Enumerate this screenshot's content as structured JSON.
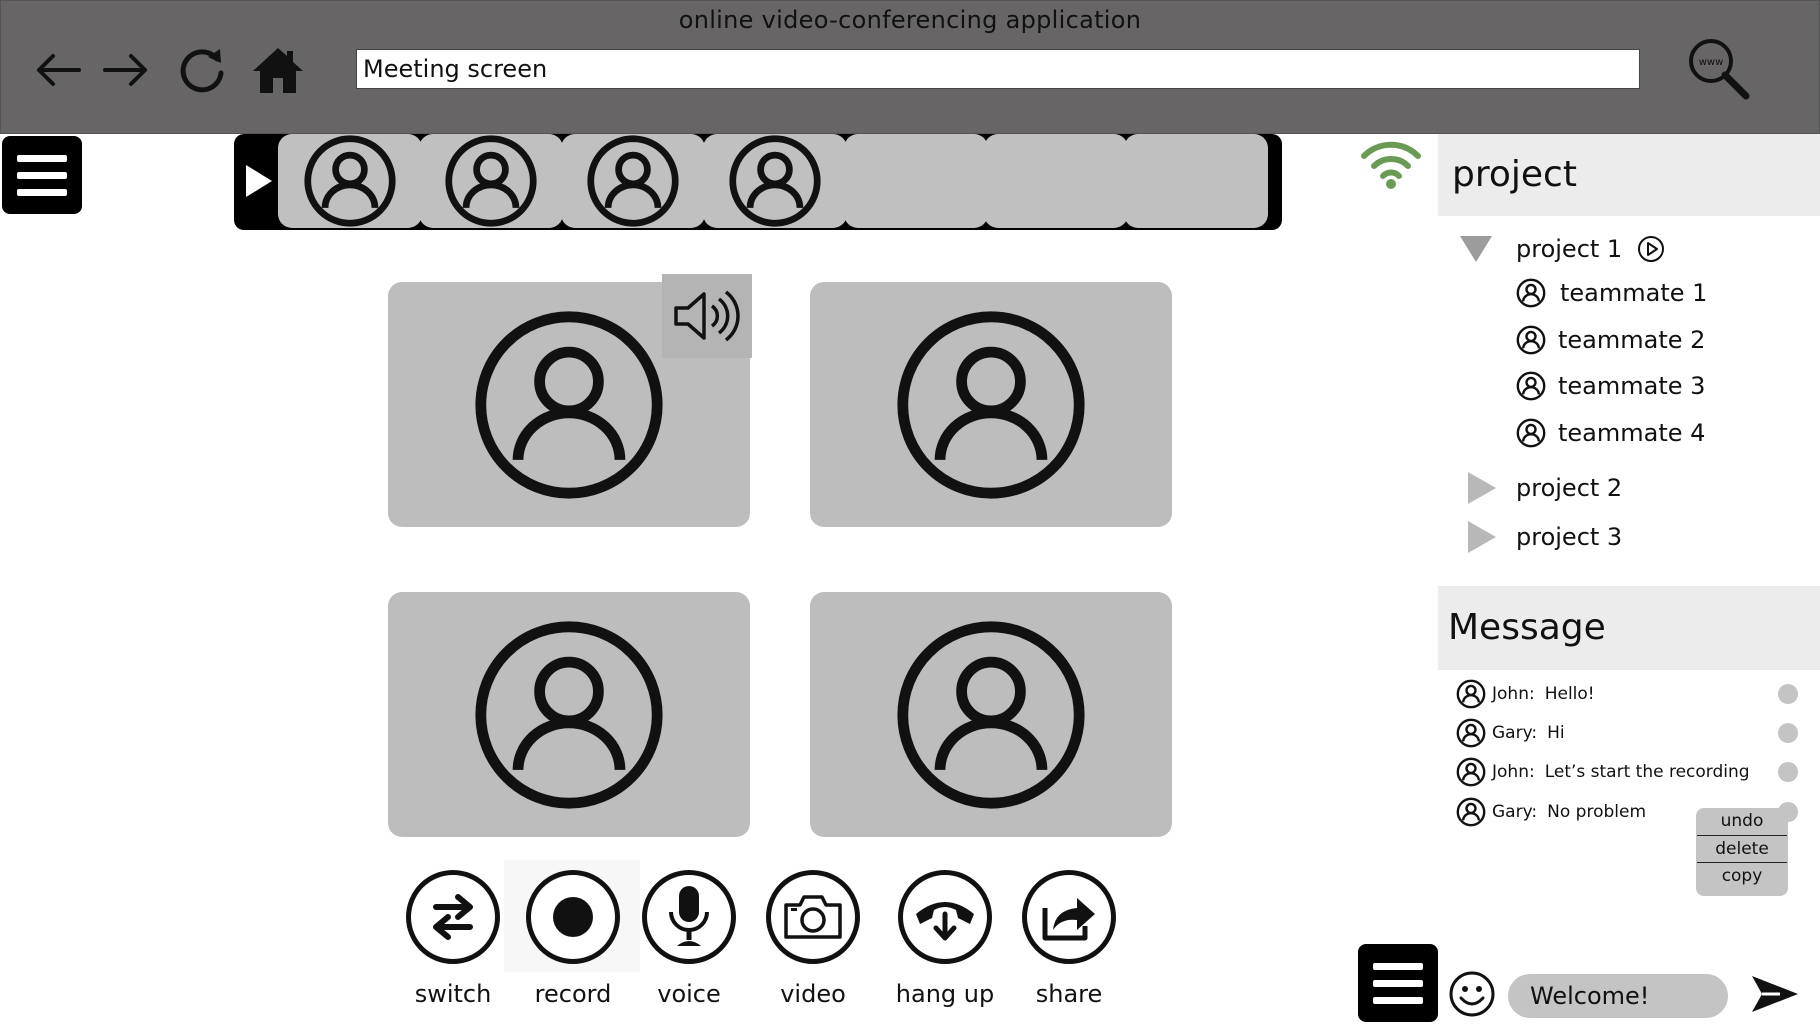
{
  "app": {
    "title": "online video-conferencing  application",
    "address_value": "Meeting screen"
  },
  "icons": {
    "back": "arrow-left-icon",
    "forward": "arrow-right-icon",
    "reload": "reload-icon",
    "home": "home-icon",
    "search": "search-www-icon",
    "menu": "hamburger-menu-icon",
    "wifi": "wifi-icon",
    "speaker": "speaker-icon",
    "emoji": "smiley-icon",
    "send": "send-icon"
  },
  "colors": {
    "topbar": "#676565",
    "tile": "#bdbdbd",
    "wifi": "#6a9b55",
    "panel_head": "#ececec"
  },
  "participant_strip": {
    "filled_slots": 4,
    "empty_slots": 3
  },
  "controls": [
    {
      "id": "switch",
      "label": "switch"
    },
    {
      "id": "record",
      "label": "record"
    },
    {
      "id": "voice",
      "label": "voice"
    },
    {
      "id": "video",
      "label": "video"
    },
    {
      "id": "hangup",
      "label": "hang up"
    },
    {
      "id": "share",
      "label": "share"
    }
  ],
  "projects_panel": {
    "title": "project",
    "projects": [
      {
        "name": "project 1",
        "expanded": true,
        "members": [
          "teammate 1",
          "teammate 2",
          "teammate 3",
          "teammate 4"
        ]
      },
      {
        "name": "project 2",
        "expanded": false
      },
      {
        "name": "project 3",
        "expanded": false
      }
    ]
  },
  "messages_panel": {
    "title": "Message",
    "messages": [
      {
        "sender": "John:",
        "text": "Hello!"
      },
      {
        "sender": "Gary:",
        "text": "Hi"
      },
      {
        "sender": "John:",
        "text": "Let’s start the recording"
      },
      {
        "sender": "Gary:",
        "text": "No problem"
      }
    ],
    "context_menu": [
      "undo",
      "delete",
      "copy"
    ],
    "input_value": "Welcome!"
  }
}
